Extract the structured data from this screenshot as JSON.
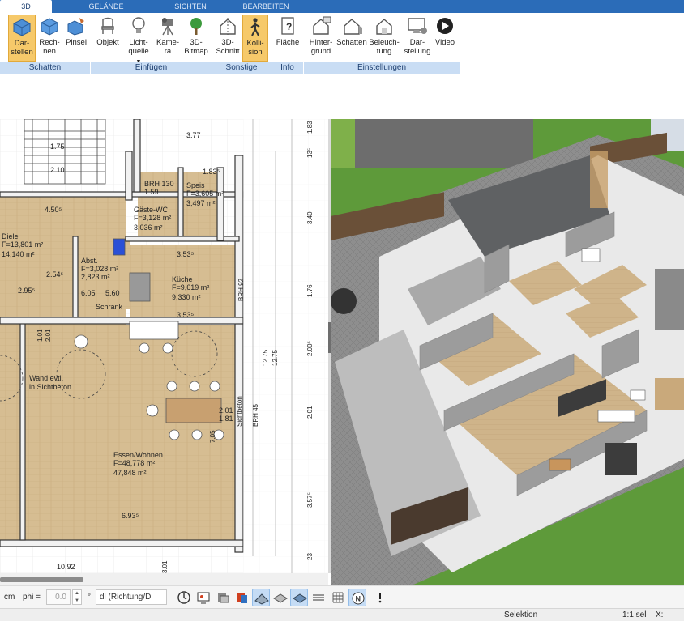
{
  "ribbon_tabs": [
    "3D",
    "GELÄNDE",
    "SICHTEN",
    "BEARBEITEN"
  ],
  "buttons": {
    "darstellen": [
      "Dar-",
      "stellen"
    ],
    "rechnen": [
      "Rech-",
      "nen"
    ],
    "pinsel": [
      "Pinsel"
    ],
    "objekt": [
      "Objekt"
    ],
    "lichtquelle": [
      "Licht-",
      "quelle"
    ],
    "kamera": [
      "Kame-",
      "ra"
    ],
    "bitmap": [
      "3D-",
      "Bitmap"
    ],
    "schnitt": [
      "3D-",
      "Schnitt"
    ],
    "kollision": [
      "Kolli-",
      "sion"
    ],
    "flaeche": [
      "Fläche"
    ],
    "hintergrund": [
      "Hinter-",
      "grund"
    ],
    "schatten": [
      "Schatten"
    ],
    "beleuchtung": [
      "Beleuch-",
      "tung"
    ],
    "darstellung": [
      "Dar-",
      "stellung"
    ],
    "video": [
      "Video"
    ]
  },
  "groups": [
    "Schatten",
    "Einfügen",
    "Sonstige",
    "Info",
    "Einstellungen"
  ],
  "plan": {
    "rooms": [
      {
        "name": "Diele",
        "f": "F=13,801 m²",
        "a": "14,140 m²"
      },
      {
        "name": "Abst.",
        "f": "F=3,028 m²",
        "a": "2,823 m²"
      },
      {
        "name": "Gäste-WC",
        "f": "F=3,128 m²",
        "a": "3,036 m²"
      },
      {
        "name": "Speis",
        "f": "F=3,605 m²",
        "a": "3,497 m²"
      },
      {
        "name": "Küche",
        "f": "F=9,619 m²",
        "a": "9,330 m²"
      },
      {
        "name": "Essen/Wohnen",
        "f": "F=48,778 m²",
        "a": "47,848 m²"
      }
    ],
    "dims": [
      "3.77",
      "1.83⁵",
      "4.50⁵",
      "2.95⁵",
      "3.53⁵",
      "3.53⁵",
      "6.93⁵",
      "10.92",
      "2.54⁵",
      "1.75",
      "2.10",
      "6.05",
      "5.60"
    ],
    "right_dims": [
      "1.83",
      "13⁵",
      "3.40",
      "1.76",
      "2.00⁵",
      "2.01",
      "3.57⁵",
      "23",
      "12.75",
      "12.75"
    ],
    "notes": [
      "Wand evtl.",
      "in Sichtbeton"
    ],
    "labels": [
      "BRH 130",
      "1.59",
      "BRH 92",
      "BRH 45",
      "Schrank",
      "Sichtbeton",
      "3.01",
      "2.01",
      "1.81",
      "1.01",
      "2.01",
      "7.05"
    ]
  },
  "toolbar": {
    "unit": "cm",
    "phi_label": "phi =",
    "phi_value": "0.0",
    "degree": "°",
    "mode_select": "dl (Richtung/Di"
  },
  "status": {
    "selektion": "Selektion",
    "sel": "1:1 sel",
    "x": "X:"
  },
  "colors": {
    "ribbon_blue": "#2b6cb8",
    "group_bar": "#c9ddf4",
    "active_button": "#f6c96a",
    "floor_wood": "#d5bd93",
    "grass": "#5e9a3a"
  }
}
